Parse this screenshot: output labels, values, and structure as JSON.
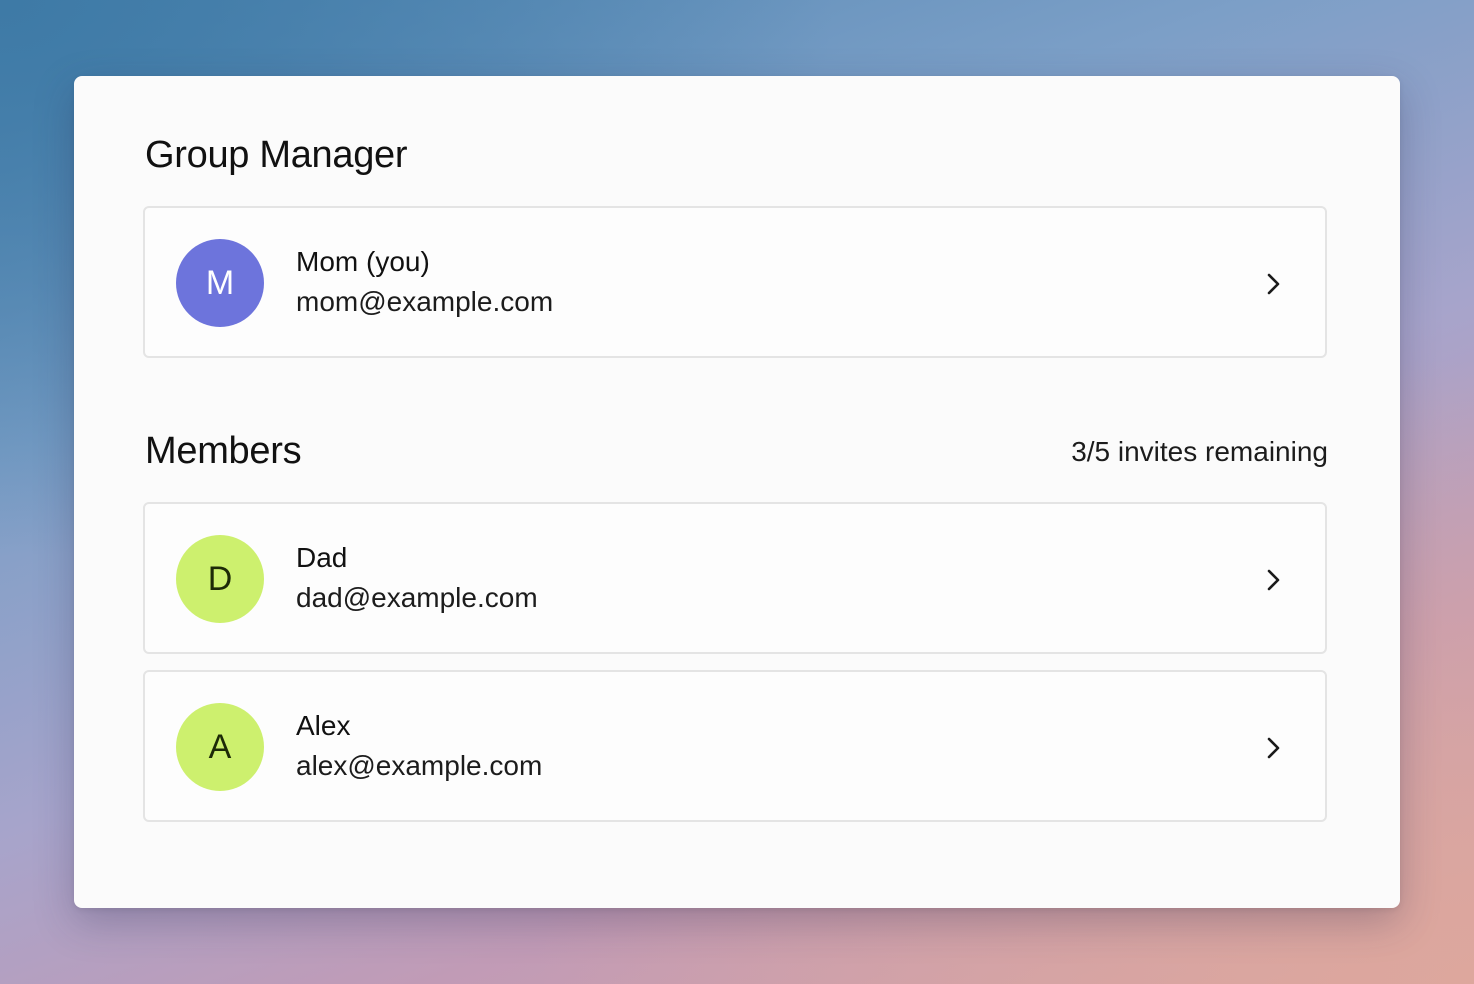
{
  "manager_section": {
    "title": "Group Manager",
    "member": {
      "initial": "M",
      "name": "Mom (you)",
      "email": "mom@example.com",
      "avatar_color": "#6d74dc"
    }
  },
  "members_section": {
    "title": "Members",
    "invites_remaining": "3/5 invites remaining",
    "members": [
      {
        "initial": "D",
        "name": "Dad",
        "email": "dad@example.com",
        "avatar_color": "#cdf06e"
      },
      {
        "initial": "A",
        "name": "Alex",
        "email": "alex@example.com",
        "avatar_color": "#cdf06e"
      }
    ]
  },
  "icons": {
    "row_action": "chevron-right-icon"
  }
}
